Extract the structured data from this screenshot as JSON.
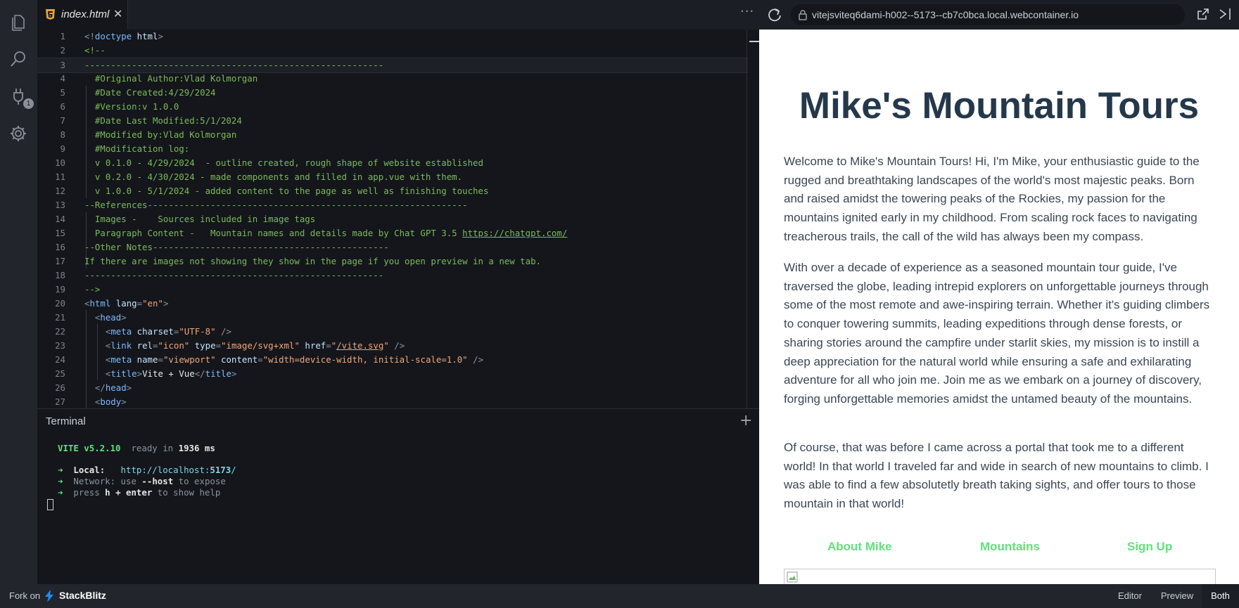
{
  "tab": {
    "label": "index.html",
    "close": "✕",
    "icon": "html5-icon"
  },
  "toolbar": {
    "more": "···",
    "url": "vitejsviteq6dami-h002--5173--cb7c0bca.local.webcontainer.io"
  },
  "activity": {
    "badge": "1",
    "icons": [
      "files-icon",
      "search-icon",
      "plug-icon",
      "gear-icon"
    ]
  },
  "editor": {
    "lines": [
      {
        "n": "1",
        "html": "<span class='c-punc'>&lt;!</span><span class='c-tag'>doctype</span> <span class='c-attr'>html</span><span class='c-punc'>&gt;</span>"
      },
      {
        "n": "2",
        "html": "<span class='c-com'>&lt;!--</span>"
      },
      {
        "n": "3",
        "html": "<span class='c-com'>---------------------------------------------------------</span>"
      },
      {
        "n": "4",
        "html": "<span class='c-com'>  #Original Author:Vlad Kolmorgan</span>"
      },
      {
        "n": "5",
        "html": "<span class='c-com'>  #Date Created:4/29/2024</span>"
      },
      {
        "n": "6",
        "html": "<span class='c-com'>  #Version:v 1.0.0</span>"
      },
      {
        "n": "7",
        "html": "<span class='c-com'>  #Date Last Modified:5/1/2024</span>"
      },
      {
        "n": "8",
        "html": "<span class='c-com'>  #Modified by:Vlad Kolmorgan</span>"
      },
      {
        "n": "9",
        "html": "<span class='c-com'>  #Modification log:</span>"
      },
      {
        "n": "10",
        "html": "<span class='c-com'>  v 0.1.0 - 4/29/2024  - outline created, rough shape of website established</span>"
      },
      {
        "n": "11",
        "html": "<span class='c-com'>  v 0.2.0 - 4/30/2024 - made components and filled in app.vue with them.</span>"
      },
      {
        "n": "12",
        "html": "<span class='c-com'>  v 1.0.0 - 5/1/2024 - added content to the page as well as finishing touches</span>"
      },
      {
        "n": "13",
        "html": "<span class='c-com'>--References-------------------------------------------------------------</span>"
      },
      {
        "n": "14",
        "html": "<span class='c-com'>  Images -    Sources included in image tags</span>"
      },
      {
        "n": "15",
        "html": "<span class='c-com'>  Paragraph Content -   Mountain names and details made by Chat GPT 3.5 </span><span class='c-link'>https://chatgpt.com/</span>"
      },
      {
        "n": "16",
        "html": "<span class='c-com'>--Other Notes---------------------------------------------</span>"
      },
      {
        "n": "17",
        "html": "<span class='c-com'>If there are images not showing they show in the page if you open preview in a new tab.</span>"
      },
      {
        "n": "18",
        "html": "<span class='c-com'>---------------------------------------------------------</span>"
      },
      {
        "n": "19",
        "html": "<span class='c-com'>--&gt;</span>"
      },
      {
        "n": "20",
        "html": "<span class='c-punc'>&lt;</span><span class='c-tag'>html</span> <span class='c-attr'>lang</span><span class='c-punc'>=</span><span class='c-str'>\"en\"</span><span class='c-punc'>&gt;</span>"
      },
      {
        "n": "21",
        "html": "  <span class='c-punc'>&lt;</span><span class='c-tag'>head</span><span class='c-punc'>&gt;</span>"
      },
      {
        "n": "22",
        "html": "    <span class='c-punc'>&lt;</span><span class='c-tag'>meta</span> <span class='c-attr'>charset</span><span class='c-punc'>=</span><span class='c-str'>\"UTF-8\"</span> <span class='c-punc'>/&gt;</span>"
      },
      {
        "n": "23",
        "html": "    <span class='c-punc'>&lt;</span><span class='c-tag'>link</span> <span class='c-attr'>rel</span><span class='c-punc'>=</span><span class='c-str'>\"icon\"</span> <span class='c-attr'>type</span><span class='c-punc'>=</span><span class='c-str'>\"image/svg+xml\"</span> <span class='c-attr'>href</span><span class='c-punc'>=</span><span class='c-str'>\"</span><span class='c-str' style='text-decoration:underline'>/vite.svg</span><span class='c-str'>\"</span> <span class='c-punc'>/&gt;</span>"
      },
      {
        "n": "24",
        "html": "    <span class='c-punc'>&lt;</span><span class='c-tag'>meta</span> <span class='c-attr'>name</span><span class='c-punc'>=</span><span class='c-str'>\"viewport\"</span> <span class='c-attr'>content</span><span class='c-punc'>=</span><span class='c-str'>\"width=device-width, initial-scale=1.0\"</span> <span class='c-punc'>/&gt;</span>"
      },
      {
        "n": "25",
        "html": "    <span class='c-punc'>&lt;</span><span class='c-tag'>title</span><span class='c-punc'>&gt;</span><span class='c-text'>Vite + Vue</span><span class='c-punc'>&lt;/</span><span class='c-tag'>title</span><span class='c-punc'>&gt;</span>"
      },
      {
        "n": "26",
        "html": "  <span class='c-punc'>&lt;/</span><span class='c-tag'>head</span><span class='c-punc'>&gt;</span>"
      },
      {
        "n": "27",
        "html": "  <span class='c-punc'>&lt;</span><span class='c-tag'>body</span><span class='c-punc'>&gt;</span>"
      }
    ]
  },
  "terminal": {
    "title": "Terminal",
    "plus": "+",
    "vite": "VITE v5.2.10",
    "ready": "ready in",
    "ms": "1936",
    "ms_unit": "ms",
    "local_label": "Local:",
    "local_url_pre": "http://localhost:",
    "local_port": "5173",
    "local_url_post": "/",
    "network_label": "Network:",
    "network_text1": "use",
    "network_flag": "--host",
    "network_text2": "to expose",
    "press": "press",
    "keys": "h + enter",
    "help": "to show help",
    "arrow": "➜"
  },
  "preview": {
    "title": "Mike's Mountain Tours",
    "p1": "Welcome to Mike's Mountain Tours! Hi, I'm Mike, your enthusiastic guide to the rugged and breathtaking landscapes of the world's most majestic peaks. Born and raised amidst the towering peaks of the Rockies, my passion for the mountains ignited early in my childhood. From scaling rock faces to navigating treacherous trails, the call of the wild has always been my compass.",
    "p2": "With over a decade of experience as a seasoned mountain tour guide, I've traversed the globe, leading intrepid explorers on unforgettable journeys through some of the most remote and awe-inspiring terrain. Whether it's guiding climbers to conquer towering summits, leading expeditions through dense forests, or sharing stories around the campfire under starlit skies, my mission is to instill a deep appreciation for the natural world while ensuring a safe and exhilarating adventure for all who join me. Join me as we embark on a journey of discovery, forging unforgettable memories amidst the untamed beauty of the mountains.",
    "p3": "Of course, that was before I came across a portal that took me to a different world! In that world I traveled far and wide in search of new mountains to climb. I was able to find a few absolutetly breath taking sights, and offer tours to those mountain in that world!",
    "nav": [
      "About Mike",
      "Mountains",
      "Sign Up"
    ]
  },
  "footer": {
    "fork": "Fork on",
    "brand": "StackBlitz",
    "editor": "Editor",
    "preview": "Preview",
    "both": "Both"
  },
  "colors": {
    "accent_green": "#5ee37a",
    "title_navy": "#25384b",
    "bolt_blue": "#1e90ff"
  }
}
